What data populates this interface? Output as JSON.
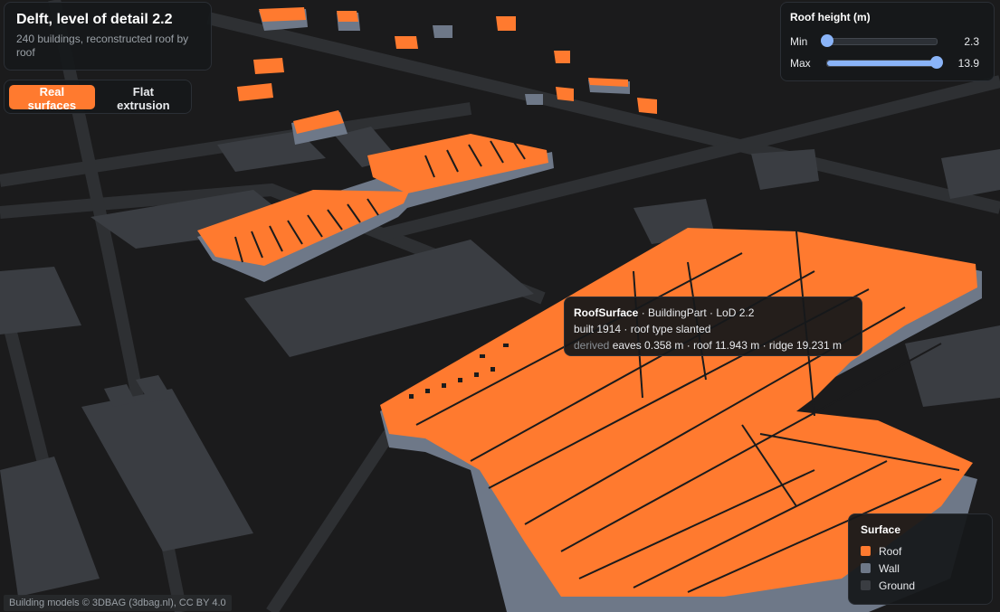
{
  "title": {
    "heading": "Delft, level of detail 2.2",
    "subtitle": "240 buildings, reconstructed roof by roof"
  },
  "mode_toggle": {
    "options": [
      "Real surfaces",
      "Flat extrusion"
    ],
    "selected": "Real surfaces"
  },
  "roof_height": {
    "heading": "Roof height (m)",
    "min": {
      "label": "Min",
      "value": "2.3",
      "position_fraction": 0.0
    },
    "max": {
      "label": "Max",
      "value": "13.9",
      "position_fraction": 1.0
    }
  },
  "tooltip": {
    "surface": "RoofSurface",
    "line1_rest": "· BuildingPart · LoD 2.2",
    "line2": "built 1914 · roof type slanted",
    "derived_label": "derived",
    "line3_rest": "eaves 0.358 m · roof 11.943 m · ridge 19.231 m"
  },
  "legend": {
    "heading": "Surface",
    "items": [
      {
        "label": "Roof",
        "color": "#ff7a2f"
      },
      {
        "label": "Wall",
        "color": "#6e7888"
      },
      {
        "label": "Ground",
        "color": "#3a3d42"
      }
    ]
  },
  "attribution": "Building models © 3DBAG (3dbag.nl), CC BY 4.0",
  "colors": {
    "roof": "#ff7a2f",
    "wall": "#6e7888",
    "ground": "#3a3d42",
    "background": "#1b1b1c",
    "road": "#2a2b2d",
    "accent": "#8ab4f8"
  }
}
